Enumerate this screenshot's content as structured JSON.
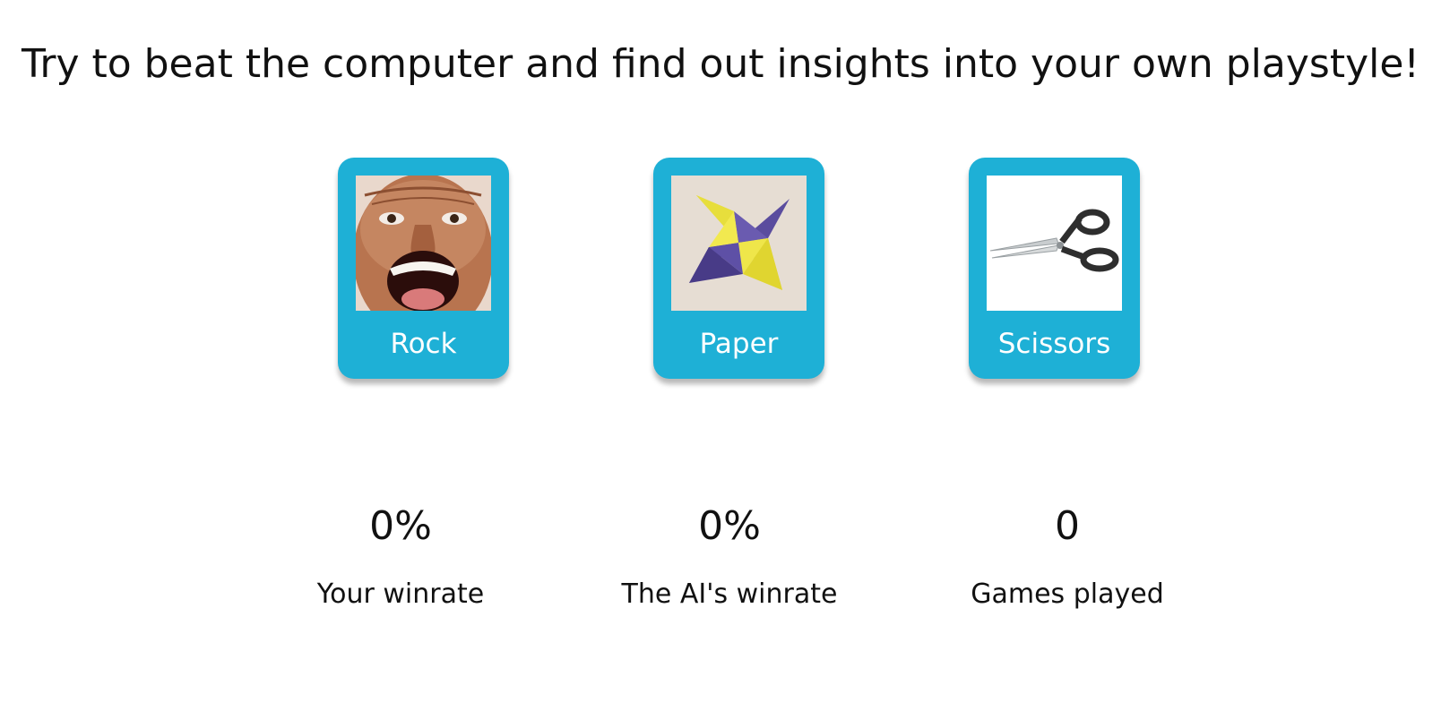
{
  "headline": "Try to beat the computer and find out insights into your own playstyle!",
  "choices": [
    {
      "id": "rock",
      "label": "Rock",
      "image_icon": "rock-face-photo"
    },
    {
      "id": "paper",
      "label": "Paper",
      "image_icon": "paper-ninja-star-photo"
    },
    {
      "id": "scissors",
      "label": "Scissors",
      "image_icon": "scissors-photo"
    }
  ],
  "stats": [
    {
      "value": "0%",
      "label": "Your winrate"
    },
    {
      "value": "0%",
      "label": "The AI's winrate"
    },
    {
      "value": "0",
      "label": "Games played"
    }
  ],
  "colors": {
    "card_background": "#1eb0d6",
    "card_label": "#ffffff",
    "text": "#111111"
  }
}
